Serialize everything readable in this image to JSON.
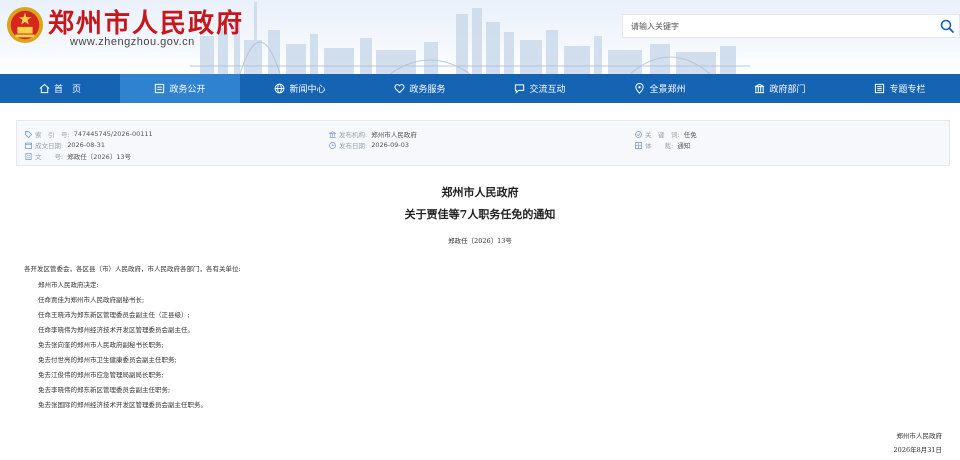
{
  "header": {
    "site_title": "郑州市人民政府",
    "site_url": "www.zhengzhou.gov.cn",
    "search_placeholder": "请输入关键字"
  },
  "nav": {
    "items": [
      {
        "label": "首　页",
        "icon": "home-icon"
      },
      {
        "label": "政务公开",
        "icon": "document-icon",
        "active": true
      },
      {
        "label": "新闻中心",
        "icon": "globe-icon"
      },
      {
        "label": "政务服务",
        "icon": "heart-icon"
      },
      {
        "label": "交流互动",
        "icon": "chat-icon"
      },
      {
        "label": "全景郑州",
        "icon": "location-icon"
      },
      {
        "label": "政府部门",
        "icon": "building-icon"
      },
      {
        "label": "专题专栏",
        "icon": "list-icon"
      }
    ]
  },
  "meta": {
    "index_label": "索　引　号:",
    "index_value": "747445745/2026-00111",
    "written_label": "成文日期:",
    "written_value": "2026-08-31",
    "docno_label": "文　　号:",
    "docno_value": "郑政任〔2026〕13号",
    "publisher_label": "发布机构:",
    "publisher_value": "郑州市人民政府",
    "pubdate_label": "发布日期:",
    "pubdate_value": "2026-09-03",
    "keyword_label": "关　键　词:",
    "keyword_value": "任免",
    "genre_label": "体　　裁:",
    "genre_value": "通知"
  },
  "article": {
    "issuer": "郑州市人民政府",
    "title": "关于贾佳等7人职务任免的通知",
    "doc_no": "郑政任〔2026〕13号",
    "addressee": "各开发区管委会，各区县（市）人民政府，市人民政府各部门，各有关单位:",
    "paragraphs": [
      "郑州市人民政府决定:",
      "任命贾佳为郑州市人民政府副秘书长;",
      "任命王晓沛为郑东新区管理委员会副主任（正县级）;",
      "任命李晓伟为郑州经济技术开发区管理委员会副主任。",
      "免去张向奎的郑州市人民政府副秘书长职务;",
      "免去付世亮的郑州市卫生健康委员会副主任职务;",
      "免去江俊伟的郑州市应急管理局副局长职务;",
      "免去李晓伟的郑东新区管理委员会副主任职务;",
      "免去张国际的郑州经济技术开发区管理委员会副主任职务。"
    ],
    "signature": "郑州市人民政府",
    "date": "2026年8月31日"
  },
  "colors": {
    "nav_bg": "#1563b3",
    "nav_active": "#2e82cf",
    "title_red": "#c8161d",
    "meta_bg": "#f6f8fb"
  }
}
